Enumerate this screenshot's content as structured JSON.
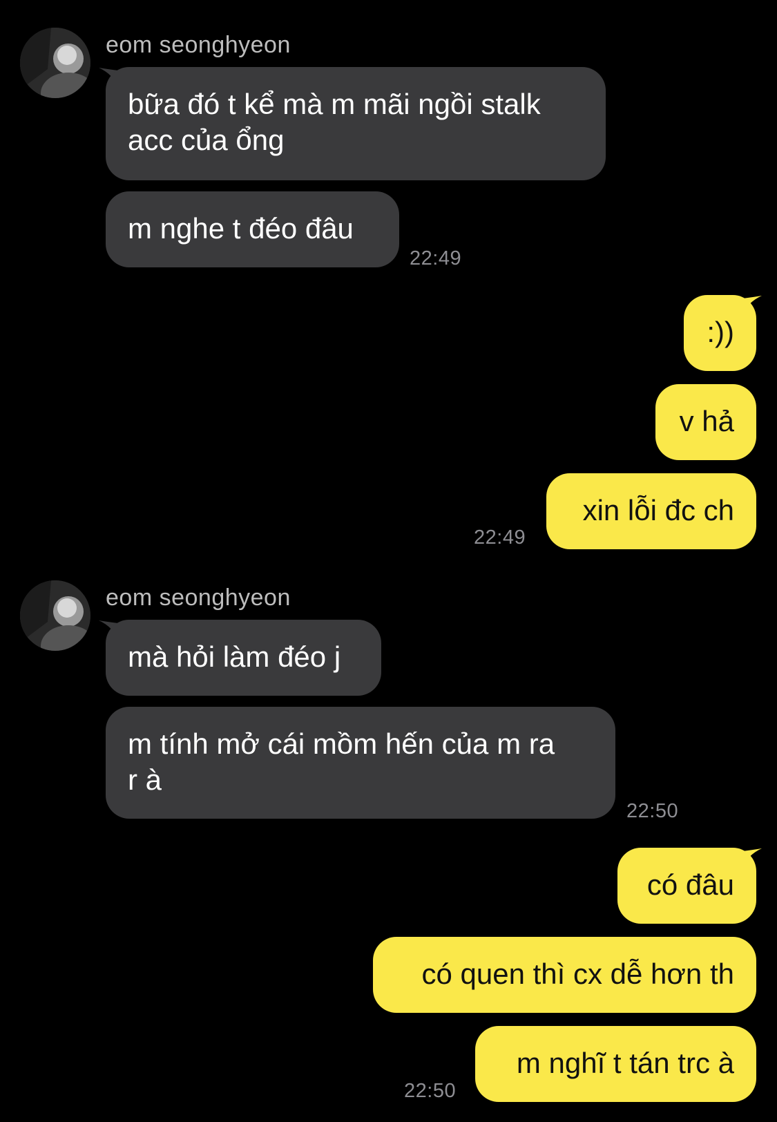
{
  "colors": {
    "background": "#000000",
    "incoming_bubble": "#3a3a3c",
    "outgoing_bubble": "#fae84a",
    "sender_name": "#bdbdbd",
    "timestamp": "#8e8e93"
  },
  "conversation": {
    "group1": {
      "sender": "eom seonghyeon",
      "avatar_icon": "profile-photo-icon",
      "messages": [
        "bữa đó t kể mà m mãi ngồi stalk\nacc của ổng",
        "m nghe t đéo đâu"
      ],
      "time": "22:49"
    },
    "group2": {
      "messages": [
        ":))",
        "v hả",
        "xin lỗi đc ch"
      ],
      "time": "22:49"
    },
    "group3": {
      "sender": "eom seonghyeon",
      "avatar_icon": "profile-photo-icon",
      "messages": [
        "mà hỏi làm đéo j",
        "m tính mở cái mồm hến của m ra\nr à"
      ],
      "time": "22:50"
    },
    "group4": {
      "messages": [
        "có đâu",
        "có quen thì cx dễ hơn th",
        "m nghĩ t tán trc à"
      ],
      "time": "22:50"
    }
  }
}
